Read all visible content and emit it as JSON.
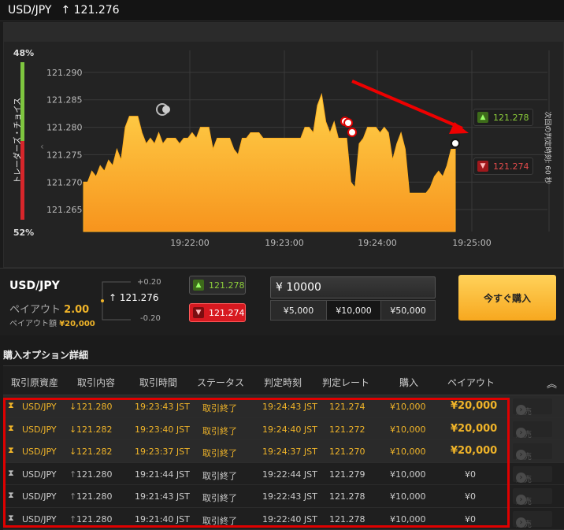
{
  "header": {
    "pair": "USD/JPY",
    "arrow": "↑",
    "rate": "121.276"
  },
  "trader_choice": {
    "label": "トレーダーズ・チョイス",
    "high_pct": "48%",
    "low_pct": "52%",
    "high_color": "#7ec63f",
    "low_color": "#d7262b"
  },
  "countdown": {
    "label": "次回の判定時刻: 60 秒"
  },
  "chart_data": {
    "type": "area",
    "y_ticks": [
      "121.290",
      "121.285",
      "121.280",
      "121.275",
      "121.270",
      "121.265"
    ],
    "ylim": [
      121.261,
      121.294
    ],
    "x_ticks": [
      "19:22:00",
      "19:23:00",
      "19:24:00",
      "19:25:00"
    ],
    "series": [
      {
        "values": [
          121.27,
          121.27,
          121.272,
          121.271,
          121.273,
          121.272,
          121.274,
          121.273,
          121.276,
          121.274,
          121.28,
          121.282,
          121.282,
          121.282,
          121.279,
          121.277,
          121.278,
          121.277,
          121.279,
          121.277,
          121.278,
          121.278,
          121.278,
          121.277,
          121.278,
          121.278,
          121.279,
          121.278,
          121.28,
          121.28,
          121.28,
          121.276,
          121.278,
          121.278,
          121.278,
          121.278,
          121.276,
          121.275,
          121.278,
          121.278,
          121.279,
          121.279,
          121.279,
          121.278,
          121.278,
          121.278,
          121.278,
          121.278,
          121.278,
          121.278,
          121.278,
          121.278,
          121.278,
          121.28,
          121.28,
          121.279,
          121.284,
          121.286,
          121.281,
          121.279,
          121.281,
          121.278,
          121.278,
          121.278,
          121.27,
          121.269,
          121.277,
          121.278,
          121.28,
          121.28,
          121.28,
          121.279,
          121.28,
          121.279,
          121.274,
          121.277,
          121.279,
          121.276,
          121.268,
          121.268,
          121.268,
          121.268,
          121.268,
          121.269,
          121.271,
          121.272,
          121.271,
          121.273,
          121.276,
          121.276
        ]
      }
    ],
    "high_rate": "121.278",
    "low_rate": "121.274",
    "area_color": "#f79a1e",
    "grid": true
  },
  "trade": {
    "pair": "USD/JPY",
    "payout_label": "ペイアウト",
    "payout_multiplier": "2.00",
    "payout_amount_label": "ペイアウト額",
    "payout_amount": "¥20,000",
    "spread_plus": "+0.20",
    "spread_minus": "-0.20",
    "current_rate": "121.276",
    "high_rate": "121.278",
    "low_rate": "121.274",
    "amount": "¥ 10000",
    "presets": [
      "¥5,000",
      "¥10,000",
      "¥50,000"
    ],
    "buy_label": "今すぐ購入"
  },
  "history": {
    "title": "購入オプション詳細",
    "columns": [
      "取引原資産",
      "取引内容",
      "取引時間",
      "ステータス",
      "判定時刻",
      "判定レート",
      "購入",
      "ペイアウト"
    ],
    "sell_label": "販売",
    "rows": [
      {
        "asset": "USD/JPY",
        "dir": "↓",
        "rate": "121.280",
        "time": "19:23:43 JST",
        "status": "取引終了",
        "judge_time": "19:24:43 JST",
        "judge_rate": "121.274",
        "amount": "¥10,000",
        "payout": "¥20,000",
        "win": true
      },
      {
        "asset": "USD/JPY",
        "dir": "↓",
        "rate": "121.282",
        "time": "19:23:40 JST",
        "status": "取引終了",
        "judge_time": "19:24:40 JST",
        "judge_rate": "121.272",
        "amount": "¥10,000",
        "payout": "¥20,000",
        "win": true
      },
      {
        "asset": "USD/JPY",
        "dir": "↓",
        "rate": "121.282",
        "time": "19:23:37 JST",
        "status": "取引終了",
        "judge_time": "19:24:37 JST",
        "judge_rate": "121.270",
        "amount": "¥10,000",
        "payout": "¥20,000",
        "win": true
      },
      {
        "asset": "USD/JPY",
        "dir": "↑",
        "rate": "121.280",
        "time": "19:21:44 JST",
        "status": "取引終了",
        "judge_time": "19:22:44 JST",
        "judge_rate": "121.279",
        "amount": "¥10,000",
        "payout": "¥0",
        "win": false
      },
      {
        "asset": "USD/JPY",
        "dir": "↑",
        "rate": "121.280",
        "time": "19:21:43 JST",
        "status": "取引終了",
        "judge_time": "19:22:43 JST",
        "judge_rate": "121.278",
        "amount": "¥10,000",
        "payout": "¥0",
        "win": false
      },
      {
        "asset": "USD/JPY",
        "dir": "↑",
        "rate": "121.280",
        "time": "19:21:40 JST",
        "status": "取引終了",
        "judge_time": "19:22:40 JST",
        "judge_rate": "121.278",
        "amount": "¥10,000",
        "payout": "¥0",
        "win": false
      }
    ]
  }
}
